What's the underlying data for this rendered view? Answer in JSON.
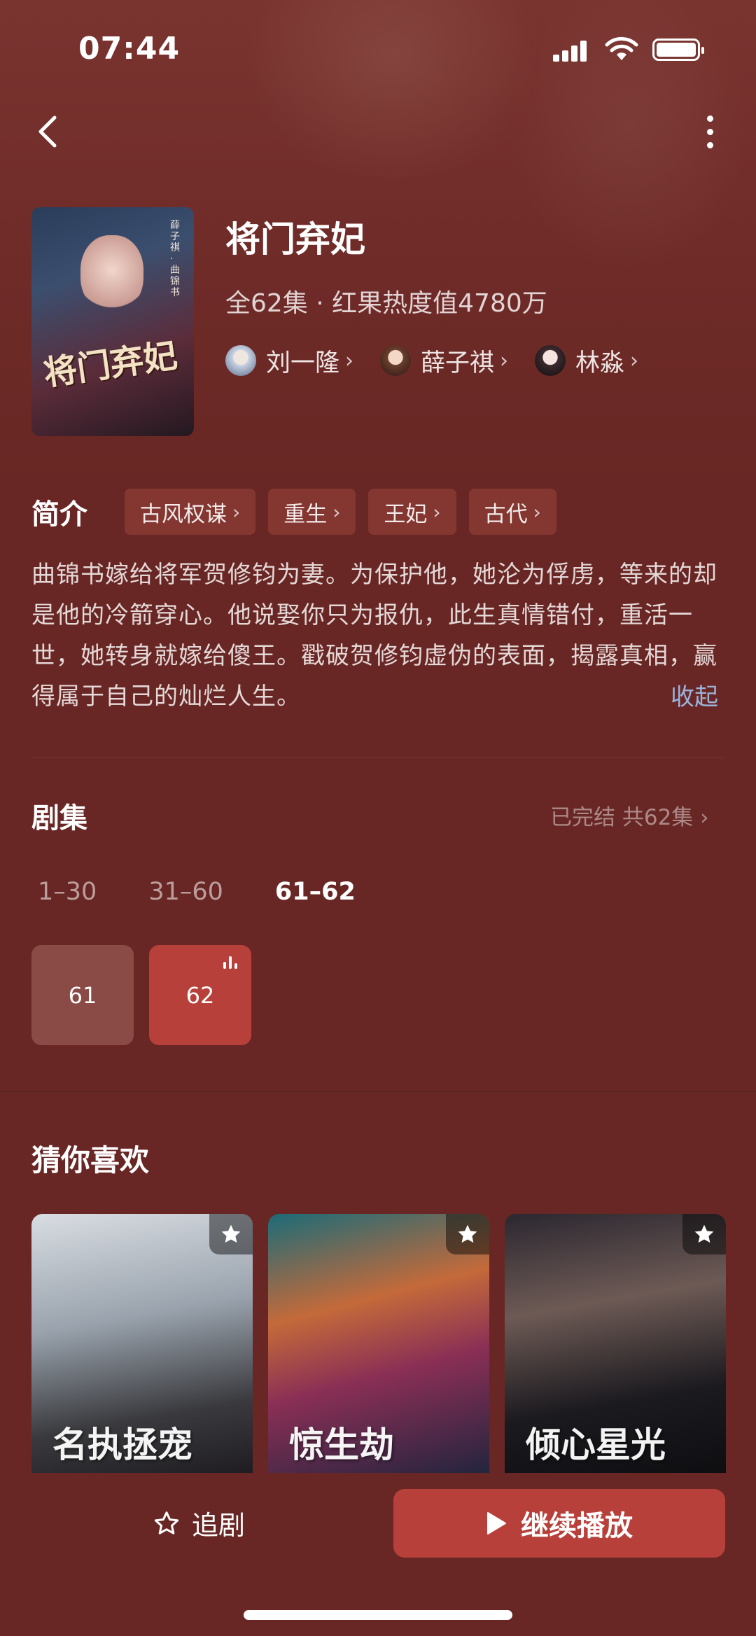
{
  "status_bar": {
    "time": "07:44"
  },
  "drama": {
    "title": "将门弃妃",
    "meta": "全62集 · 红果热度值4780万",
    "poster_title": "将门弃妃",
    "poster_side_text": "薛子祺·曲锦书",
    "cast": [
      {
        "name": "刘一隆",
        "avatar_color": "#c9d4e4"
      },
      {
        "name": "薛子祺",
        "avatar_color": "#6b3e2e"
      },
      {
        "name": "林淼",
        "avatar_color": "#3a2a2e"
      }
    ]
  },
  "intro": {
    "heading": "简介",
    "tags": [
      "古风权谋",
      "重生",
      "王妃",
      "古代"
    ],
    "description": "曲锦书嫁给将军贺修钧为妻。为保护他，她沦为俘虏，等来的却是他的冷箭穿心。他说娶你只为报仇，此生真情错付，重活一世，她转身就嫁给傻王。戳破贺修钧虚伪的表面，揭露真相，赢得属于自己的灿烂人生。",
    "collapse_label": "收起"
  },
  "episodes": {
    "heading": "剧集",
    "status": "已完结 共62集",
    "ranges": [
      "1–30",
      "31–60",
      "61–62"
    ],
    "active_range": "61–62",
    "items": [
      "61",
      "62"
    ],
    "playing": "62"
  },
  "recommend": {
    "heading": "猜你喜欢",
    "items": [
      {
        "title": "名执拯宠"
      },
      {
        "title": "惊生劫"
      },
      {
        "title": "倾心星光"
      }
    ]
  },
  "bottom_bar": {
    "follow_label": "追剧",
    "play_label": "继续播放"
  },
  "colors": {
    "background": "#682724",
    "accent": "#b8403a",
    "link": "#9cb3dc"
  }
}
